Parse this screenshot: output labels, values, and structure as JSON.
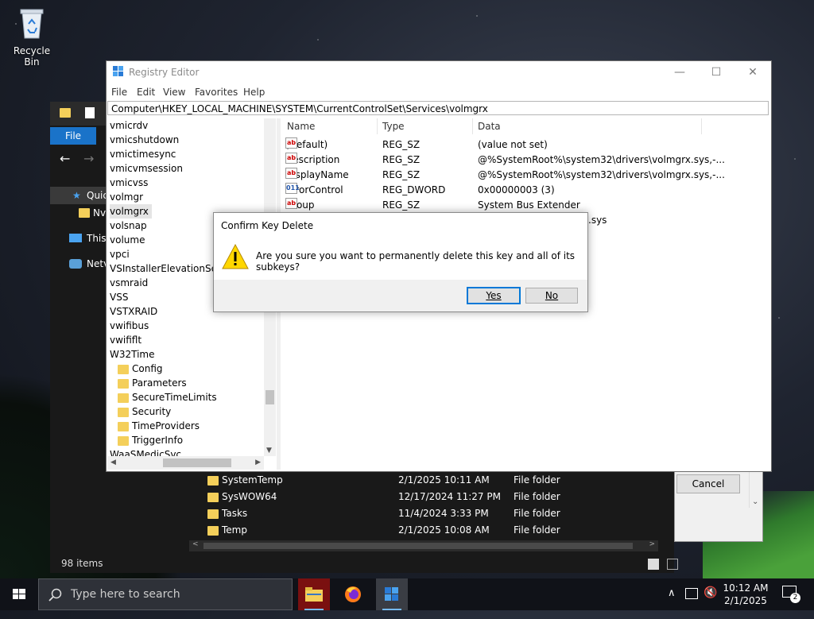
{
  "desktop": {
    "recycle_bin_label": "Recycle Bin"
  },
  "explorer": {
    "file_tab": "File",
    "sidebar": [
      "Quic",
      "Nv",
      "This",
      "Netv"
    ],
    "rows": [
      {
        "name": "SystemTemp",
        "date": "2/1/2025 10:11 AM",
        "type": "File folder"
      },
      {
        "name": "SysWOW64",
        "date": "12/17/2024 11:27 PM",
        "type": "File folder"
      },
      {
        "name": "Tasks",
        "date": "11/4/2024 3:33 PM",
        "type": "File folder"
      },
      {
        "name": "Temp",
        "date": "2/1/2025 10:08 AM",
        "type": "File folder"
      }
    ],
    "status": "98 items"
  },
  "peek_dialog": {
    "cancel_label": "Cancel"
  },
  "regedit": {
    "title": "Registry Editor",
    "menu": [
      "File",
      "Edit",
      "View",
      "Favorites",
      "Help"
    ],
    "address": "Computer\\HKEY_LOCAL_MACHINE\\SYSTEM\\CurrentControlSet\\Services\\volmgrx",
    "tree": [
      {
        "label": "vmicrdv",
        "indent": 0
      },
      {
        "label": "vmicshutdown",
        "indent": 0
      },
      {
        "label": "vmictimesync",
        "indent": 0
      },
      {
        "label": "vmicvmsession",
        "indent": 0
      },
      {
        "label": "vmicvss",
        "indent": 0
      },
      {
        "label": "volmgr",
        "indent": 0
      },
      {
        "label": "volmgrx",
        "indent": 0,
        "selected": true
      },
      {
        "label": "volsnap",
        "indent": 0
      },
      {
        "label": "volume",
        "indent": 0
      },
      {
        "label": "vpci",
        "indent": 0
      },
      {
        "label": "VSInstallerElevationService",
        "indent": 0
      },
      {
        "label": "vsmraid",
        "indent": 0
      },
      {
        "label": "VSS",
        "indent": 0
      },
      {
        "label": "VSTXRAID",
        "indent": 0
      },
      {
        "label": "vwifibus",
        "indent": 0
      },
      {
        "label": "vwififlt",
        "indent": 0
      },
      {
        "label": "W32Time",
        "indent": 0
      },
      {
        "label": "Config",
        "indent": 1
      },
      {
        "label": "Parameters",
        "indent": 1
      },
      {
        "label": "SecureTimeLimits",
        "indent": 1
      },
      {
        "label": "Security",
        "indent": 1
      },
      {
        "label": "TimeProviders",
        "indent": 1
      },
      {
        "label": "TriggerInfo",
        "indent": 1
      },
      {
        "label": "WaaSMedicSvc",
        "indent": 0
      }
    ],
    "columns": {
      "name": "Name",
      "type": "Type",
      "data": "Data"
    },
    "values": [
      {
        "icon": "string",
        "name": "(Default)",
        "type": "REG_SZ",
        "data": "(value not set)"
      },
      {
        "icon": "string",
        "name": "Description",
        "type": "REG_SZ",
        "data": "@%SystemRoot%\\system32\\drivers\\volmgrx.sys,-..."
      },
      {
        "icon": "string",
        "name": "DisplayName",
        "type": "REG_SZ",
        "data": "@%SystemRoot%\\system32\\drivers\\volmgrx.sys,-..."
      },
      {
        "icon": "dword",
        "name": "ErrorControl",
        "type": "REG_DWORD",
        "data": "0x00000003 (3)"
      },
      {
        "icon": "string",
        "name": "Group",
        "type": "REG_SZ",
        "data": "System Bus Extender"
      },
      {
        "icon": "string",
        "name": "",
        "type": "",
        "data": ".sys"
      }
    ]
  },
  "dialog": {
    "title": "Confirm Key Delete",
    "message": "Are you sure you want to permanently delete this key and all of its subkeys?",
    "yes": "Yes",
    "no": "No"
  },
  "taskbar": {
    "search_placeholder": "Type here to search",
    "time": "10:12 AM",
    "date": "2/1/2025",
    "notification_count": "2"
  },
  "colors": {
    "accent": "#0078d7",
    "file_tab": "#1a73c9",
    "taskbar": "#101218"
  }
}
